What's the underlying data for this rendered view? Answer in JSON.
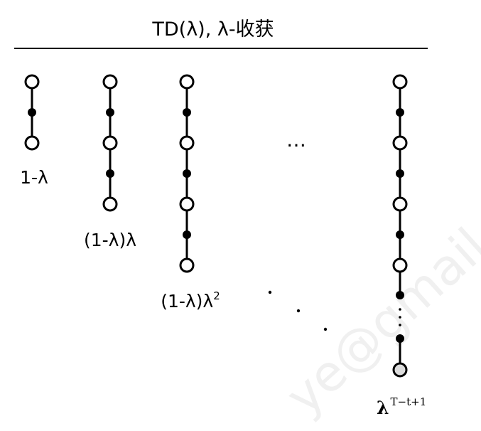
{
  "title": "TD(λ), λ-收获",
  "ellipsis": "…",
  "columns": [
    {
      "id": "col-1",
      "weight_base": "1-λ",
      "weight_exp": ""
    },
    {
      "id": "col-2",
      "weight_base": "(1-λ)λ",
      "weight_exp": ""
    },
    {
      "id": "col-3",
      "weight_base": "(1-λ)λ",
      "weight_exp": "2"
    },
    {
      "id": "col-final",
      "weight_base": "λ",
      "weight_exp": "T−t+1"
    }
  ],
  "colors": {
    "line": "#000000",
    "state_fill": "#ffffff",
    "terminal_fill": "#dcdcdc",
    "action_fill": "#000000"
  }
}
